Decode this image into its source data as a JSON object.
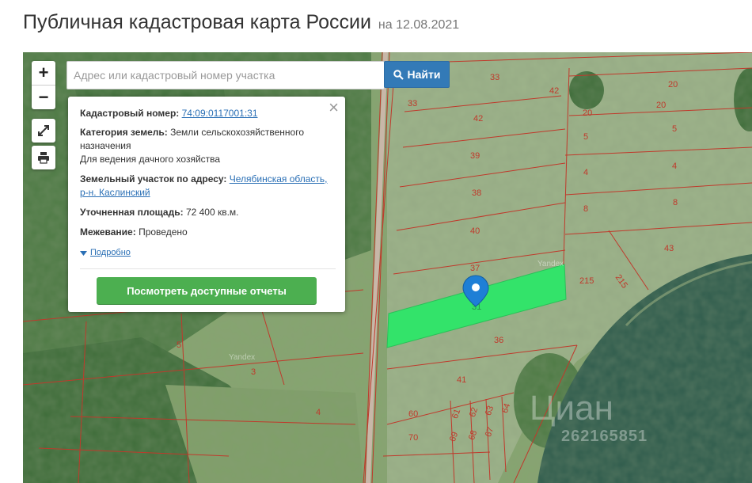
{
  "header": {
    "title": "Публичная кадастровая карта России",
    "date_prefix": "на",
    "date": "12.08.2021"
  },
  "search": {
    "placeholder": "Адрес или кадастровый номер участка",
    "button_label": "Найти"
  },
  "zoom": {
    "in_label": "+",
    "out_label": "−"
  },
  "tools": [
    {
      "icon": "fullscreen-icon"
    },
    {
      "icon": "print-icon"
    }
  ],
  "popup": {
    "cadastral_label": "Кадастровый номер:",
    "cadastral_number": "74:09:0117001:31",
    "category_label": "Категория земель:",
    "category_value": "Земли сельскохозяйственного назначения",
    "usage_value": "Для ведения дачного хозяйства",
    "address_label": "Земельный участок по адресу:",
    "address_value": "Челябинская область, р-н. Каслинский",
    "area_label": "Уточненная площадь:",
    "area_value": "72 400 кв.м.",
    "survey_label": "Межевание:",
    "survey_value": "Проведено",
    "more_label": "Подробно",
    "reports_button": "Посмотреть доступные отчеты",
    "close_icon": "close-icon"
  },
  "map": {
    "plot_numbers": [
      "33",
      "42",
      "20",
      "33",
      "42",
      "20",
      "20",
      "5",
      "5",
      "39",
      "4",
      "4",
      "38",
      "8",
      "8",
      "40",
      "43",
      "37",
      "215",
      "215",
      "36",
      "5",
      "3",
      "41",
      "4",
      "60",
      "61",
      "62",
      "63",
      "64",
      "70",
      "69",
      "68",
      "67"
    ],
    "selected_plot_label": "31",
    "yandex_label": "Yandex",
    "watermark": "Циан",
    "watermark_id": "262165851",
    "colors": {
      "selected_plot": "#33e36a",
      "marker": "#1e7fd6",
      "boundaries": "#c0392b",
      "water": "#2e5b4c"
    }
  }
}
